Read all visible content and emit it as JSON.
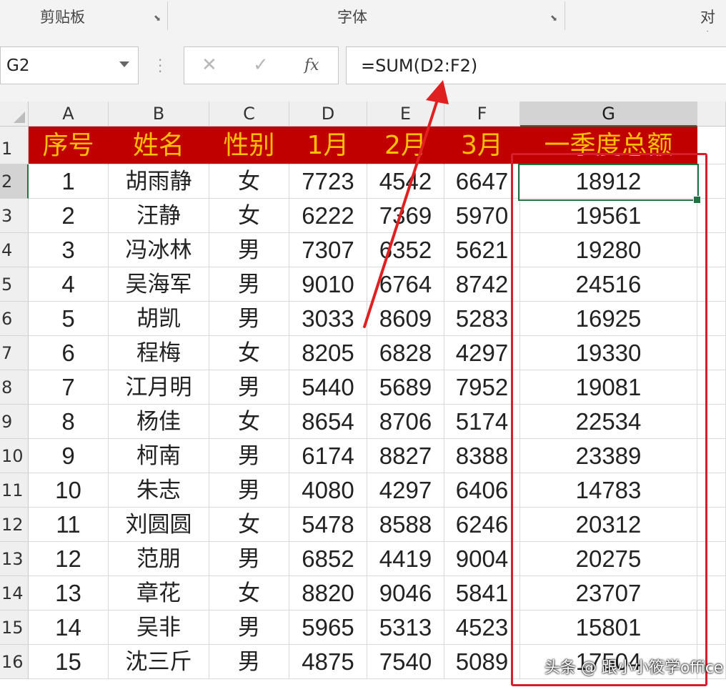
{
  "ribbon": {
    "groups": [
      "剪贴板",
      "字体",
      "对齐"
    ]
  },
  "formula_bar": {
    "name_box": "G2",
    "cancel_icon": "✕",
    "enter_icon": "✓",
    "fx_label": "fx",
    "formula": "=SUM(D2:F2)"
  },
  "sheet": {
    "columns": [
      "A",
      "B",
      "C",
      "D",
      "E",
      "F",
      "G"
    ],
    "selected_column": "G",
    "row_numbers": [
      "1",
      "2",
      "3",
      "4",
      "5",
      "6",
      "7",
      "8",
      "9",
      "10",
      "11",
      "12",
      "13",
      "14",
      "15",
      "16"
    ],
    "header_row": [
      "序号",
      "姓名",
      "性别",
      "1月",
      "2月",
      "3月",
      "一季度总额"
    ],
    "rows": [
      [
        "1",
        "胡雨静",
        "女",
        "7723",
        "4542",
        "6647",
        "18912"
      ],
      [
        "2",
        "汪静",
        "女",
        "6222",
        "7369",
        "5970",
        "19561"
      ],
      [
        "3",
        "冯冰林",
        "男",
        "7307",
        "6352",
        "5621",
        "19280"
      ],
      [
        "4",
        "吴海军",
        "男",
        "9010",
        "6764",
        "8742",
        "24516"
      ],
      [
        "5",
        "胡凯",
        "男",
        "3033",
        "8609",
        "5283",
        "16925"
      ],
      [
        "6",
        "程梅",
        "女",
        "8205",
        "6828",
        "4297",
        "19330"
      ],
      [
        "7",
        "江月明",
        "男",
        "5440",
        "5689",
        "7952",
        "19081"
      ],
      [
        "8",
        "杨佳",
        "女",
        "8654",
        "8706",
        "5174",
        "22534"
      ],
      [
        "9",
        "柯南",
        "男",
        "6174",
        "8827",
        "8388",
        "23389"
      ],
      [
        "10",
        "朱志",
        "男",
        "4080",
        "4297",
        "6406",
        "14783"
      ],
      [
        "11",
        "刘圆圆",
        "女",
        "5478",
        "8588",
        "6246",
        "20312"
      ],
      [
        "12",
        "范朋",
        "男",
        "6852",
        "4419",
        "9004",
        "20275"
      ],
      [
        "13",
        "章花",
        "女",
        "8820",
        "9046",
        "5841",
        "23707"
      ],
      [
        "14",
        "吴非",
        "男",
        "5965",
        "5313",
        "4523",
        "15801"
      ],
      [
        "15",
        "沈三斤",
        "男",
        "4875",
        "7540",
        "5089",
        "17504"
      ]
    ]
  },
  "colors": {
    "header_bg": "#c00000",
    "header_text": "#ffc000",
    "selection": "#217346",
    "highlight_box": "#d81e2c"
  },
  "watermark": "头条 @ 跟小小筱学office"
}
